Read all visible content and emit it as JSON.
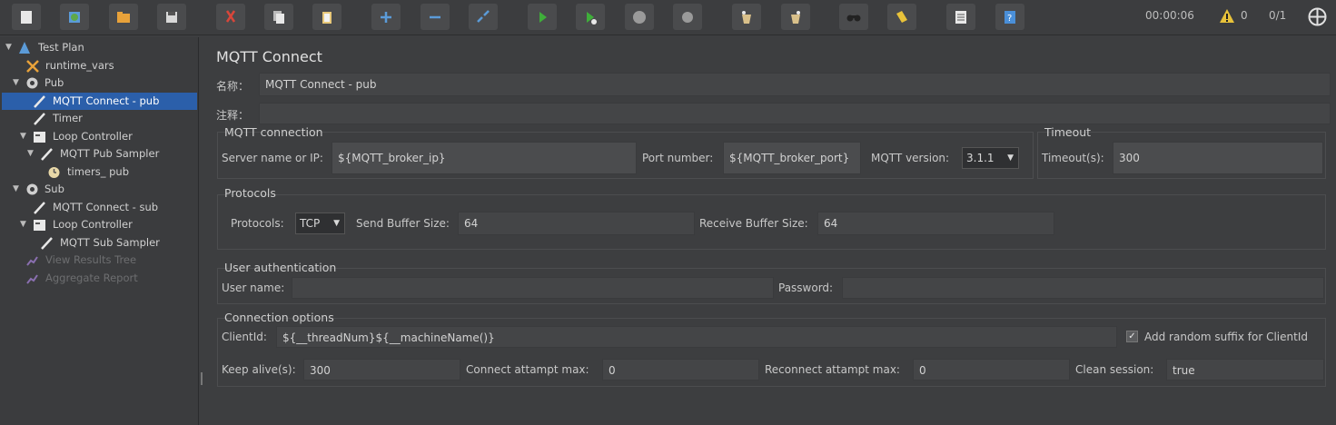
{
  "toolbar": {
    "buttons": [
      {
        "name": "new-icon",
        "color": "#e8e8e8"
      },
      {
        "name": "templates-icon",
        "color": "#5fa84a"
      },
      {
        "name": "open-icon",
        "color": "#e8a23a"
      },
      {
        "name": "save-icon",
        "color": "#d8d8d8"
      },
      {
        "name": "cut-icon",
        "color": "#d9463a"
      },
      {
        "name": "copy-icon",
        "color": "#d8d8d8"
      },
      {
        "name": "paste-icon",
        "color": "#e8c87a"
      },
      {
        "name": "expand-icon",
        "color": "#5b9bd8"
      },
      {
        "name": "collapse-icon",
        "color": "#5b9bd8"
      },
      {
        "name": "toggle-icon",
        "color": "#5b9bd8"
      },
      {
        "name": "start-icon",
        "color": "#3fae3a"
      },
      {
        "name": "start-no-pauses-icon",
        "color": "#3fae3a"
      },
      {
        "name": "stop-icon",
        "color": "#9a9a9a"
      },
      {
        "name": "shutdown-icon",
        "color": "#9a9a9a"
      },
      {
        "name": "clear-icon",
        "color": "#d9c08a"
      },
      {
        "name": "clear-all-icon",
        "color": "#d9c08a"
      },
      {
        "name": "search-icon",
        "color": "#222222"
      },
      {
        "name": "reset-search-icon",
        "color": "#e8c23a"
      },
      {
        "name": "function-helper-icon",
        "color": "#e8e8e8"
      },
      {
        "name": "help-icon",
        "color": "#4a8fd8"
      }
    ],
    "elapsed_time": "00:00:06",
    "warning_count": "0",
    "thread_count": "0/1",
    "warning_color": "#e8c23a"
  },
  "tree": {
    "nodes": [
      {
        "label": "Test Plan",
        "icon": "test-plan-icon",
        "expanded": true,
        "selected": false,
        "dim": false
      },
      {
        "label": "runtime_vars",
        "icon": "config-element-icon",
        "selected": false,
        "dim": false
      },
      {
        "label": "Pub",
        "icon": "thread-group-gear-icon",
        "expanded": true,
        "selected": false,
        "dim": false
      },
      {
        "label": "MQTT Connect - pub",
        "icon": "sampler-pen-icon",
        "selected": true,
        "dim": false
      },
      {
        "label": "Timer",
        "icon": "sampler-pen-icon",
        "selected": false,
        "dim": false
      },
      {
        "label": "Loop Controller",
        "icon": "controller-icon",
        "expanded": true,
        "selected": false,
        "dim": false
      },
      {
        "label": "MQTT Pub Sampler",
        "icon": "sampler-pen-icon",
        "expanded": true,
        "selected": false,
        "dim": false
      },
      {
        "label": "timers_ pub",
        "icon": "timer-clock-icon",
        "selected": false,
        "dim": false
      },
      {
        "label": "Sub",
        "icon": "thread-group-gear-icon",
        "expanded": true,
        "selected": false,
        "dim": false
      },
      {
        "label": "MQTT Connect - sub",
        "icon": "sampler-pen-icon",
        "selected": false,
        "dim": false
      },
      {
        "label": "Loop Controller",
        "icon": "controller-icon",
        "expanded": true,
        "selected": false,
        "dim": false
      },
      {
        "label": "MQTT Sub Sampler",
        "icon": "sampler-pen-icon",
        "selected": false,
        "dim": false
      },
      {
        "label": "View Results Tree",
        "icon": "listener-chart-icon",
        "selected": false,
        "dim": true
      },
      {
        "label": "Aggregate Report",
        "icon": "listener-chart-icon",
        "selected": false,
        "dim": true
      }
    ]
  },
  "main": {
    "title": "MQTT Connect",
    "name_label": "名称：",
    "name_value": "MQTT Connect - pub",
    "comment_label": "注释：",
    "comment_value": "",
    "connection": {
      "section_title": "MQTT connection",
      "server_label": "Server name or IP:",
      "server_value": "${MQTT_broker_ip}",
      "port_label": "Port number:",
      "port_value": "${MQTT_broker_port}",
      "version_label": "MQTT version:",
      "version_value": "3.1.1"
    },
    "timeout": {
      "section_title": "Timeout",
      "timeout_label": "Timeout(s):",
      "timeout_value": "300"
    },
    "protocols": {
      "section_title": "Protocols",
      "protocols_label": "Protocols:",
      "protocols_value": "TCP",
      "send_label": "Send Buffer Size:",
      "send_value": "64",
      "receive_label": "Receive Buffer Size:",
      "receive_value": "64"
    },
    "auth": {
      "section_title": "User authentication",
      "user_label": "User name:",
      "user_value": "",
      "password_label": "Password:",
      "password_value": ""
    },
    "options": {
      "section_title": "Connection options",
      "clientid_label": "ClientId:",
      "clientid_value": "${__threadNum}${__machineName()}",
      "random_suffix_label": "Add random suffix for ClientId",
      "random_suffix_checked": "✓",
      "keepalive_label": "Keep alive(s):",
      "keepalive_value": "300",
      "connect_max_label": "Connect attampt max:",
      "connect_max_value": "0",
      "reconnect_max_label": "Reconnect attampt max:",
      "reconnect_max_value": "0",
      "clean_session_label": "Clean session:",
      "clean_session_value": "true"
    }
  }
}
